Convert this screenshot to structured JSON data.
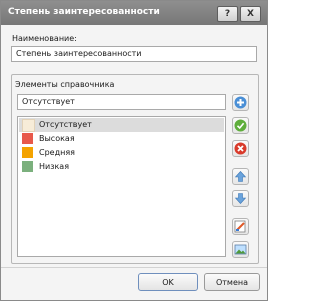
{
  "window": {
    "title": "Степень заинтересованности",
    "help_label": "?",
    "close_label": "X"
  },
  "form": {
    "name_label": "Наименование:",
    "name_value": "Степень заинтересованности",
    "group_title": "Элементы справочника",
    "edit_value": "Отсутствует"
  },
  "items": [
    {
      "label": "Отсутствует",
      "color": "#f7ecd8",
      "selected": true
    },
    {
      "label": "Высокая",
      "color": "#e8594b",
      "selected": false
    },
    {
      "label": "Средняя",
      "color": "#f4a300",
      "selected": false
    },
    {
      "label": "Низкая",
      "color": "#7bb07d",
      "selected": false
    }
  ],
  "side_buttons": [
    {
      "name": "add-item-button",
      "icon": "plus-icon"
    },
    {
      "name": "apply-button",
      "icon": "check-icon"
    },
    {
      "name": "delete-item-button",
      "icon": "close-icon"
    },
    {
      "name": "move-up-button",
      "icon": "arrow-up-icon"
    },
    {
      "name": "move-down-button",
      "icon": "arrow-down-icon"
    },
    {
      "name": "edit-color-button",
      "icon": "edit-icon"
    },
    {
      "name": "image-button",
      "icon": "image-icon"
    }
  ],
  "footer": {
    "ok_label": "OK",
    "cancel_label": "Отмена"
  }
}
